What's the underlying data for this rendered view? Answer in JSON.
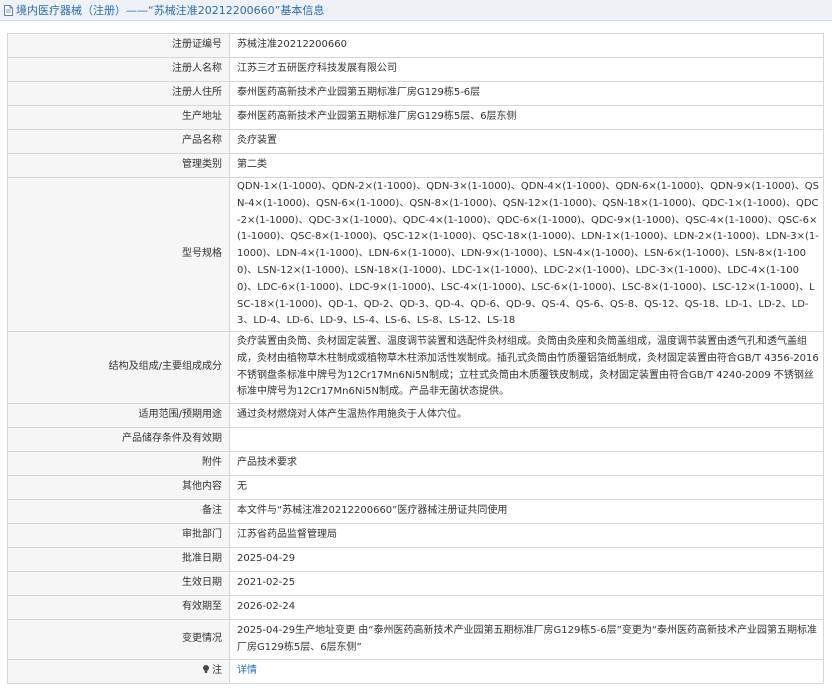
{
  "header": {
    "title": "境内医疗器械（注册）——“苏械注准20212200660”基本信息"
  },
  "rows": {
    "reg_no": {
      "label": "注册证编号",
      "value": "苏械注准20212200660"
    },
    "registrant": {
      "label": "注册人名称",
      "value": "江苏三才五研医疗科技发展有限公司"
    },
    "registrant_addr": {
      "label": "注册人住所",
      "value": "泰州医药高新技术产业园第五期标准厂房G129栋5-6层"
    },
    "prod_addr": {
      "label": "生产地址",
      "value": "泰州医药高新技术产业园第五期标准厂房G129栋5层、6层东侧"
    },
    "product_name": {
      "label": "产品名称",
      "value": "灸疗装置"
    },
    "category": {
      "label": "管理类别",
      "value": "第二类"
    },
    "models": {
      "label": "型号规格",
      "value": "QDN-1×(1-1000)、QDN-2×(1-1000)、QDN-3×(1-1000)、QDN-4×(1-1000)、QDN-6×(1-1000)、QDN-9×(1-1000)、QSN-4×(1-1000)、QSN-6×(1-1000)、QSN-8×(1-1000)、QSN-12×(1-1000)、QSN-18×(1-1000)、QDC-1×(1-1000)、QDC-2×(1-1000)、QDC-3×(1-1000)、QDC-4×(1-1000)、QDC-6×(1-1000)、QDC-9×(1-1000)、QSC-4×(1-1000)、QSC-6×(1-1000)、QSC-8×(1-1000)、QSC-12×(1-1000)、QSC-18×(1-1000)、LDN-1×(1-1000)、LDN-2×(1-1000)、LDN-3×(1-1000)、LDN-4×(1-1000)、LDN-6×(1-1000)、LDN-9×(1-1000)、LSN-4×(1-1000)、LSN-6×(1-1000)、LSN-8×(1-1000)、LSN-12×(1-1000)、LSN-18×(1-1000)、LDC-1×(1-1000)、LDC-2×(1-1000)、LDC-3×(1-1000)、LDC-4×(1-1000)、LDC-6×(1-1000)、LDC-9×(1-1000)、LSC-4×(1-1000)、LSC-6×(1-1000)、LSC-8×(1-1000)、LSC-12×(1-1000)、LSC-18×(1-1000)、QD-1、QD-2、QD-3、QD-4、QD-6、QD-9、QS-4、QS-6、QS-8、QS-12、QS-18、LD-1、LD-2、LD-3、LD-4、LD-6、LD-9、LS-4、LS-6、LS-8、LS-12、LS-18"
    },
    "structure": {
      "label": "结构及组成/主要组成成分",
      "value": "灸疗装置由灸筒、灸材固定装置、温度调节装置和选配件灸材组成。灸筒由灸座和灸筒盖组成，温度调节装置由透气孔和透气盖组成，灸材由植物草木柱制成或植物草木柱添加活性炭制成。插孔式灸筒由竹质覆铝箔纸制成，灸材固定装置由符合GB/T 4356-2016不锈钢盘条标准中牌号为12Cr17Mn6Ni5N制成；立柱式灸筒由木质覆铁皮制成，灸材固定装置由符合GB/T 4240-2009 不锈钢丝标准中牌号为12Cr17Mn6Ni5N制成。产品非无菌状态提供。"
    },
    "scope": {
      "label": "适用范围/预期用途",
      "value": "通过灸材燃烧对人体产生温热作用施灸于人体穴位。"
    },
    "storage": {
      "label": "产品储存条件及有效期",
      "value": ""
    },
    "attachment": {
      "label": "附件",
      "value": "产品技术要求"
    },
    "other": {
      "label": "其他内容",
      "value": "无"
    },
    "remark": {
      "label": "备注",
      "value": "本文件与“苏械注准20212200660”医疗器械注册证共同使用"
    },
    "dept": {
      "label": "审批部门",
      "value": "江苏省药品监督管理局"
    },
    "approve_date": {
      "label": "批准日期",
      "value": "2025-04-29"
    },
    "effective_date": {
      "label": "生效日期",
      "value": "2021-02-25"
    },
    "expiry_date": {
      "label": "有效期至",
      "value": "2026-02-24"
    },
    "changes": {
      "label": "变更情况",
      "value": "2025-04-29生产地址变更 由“泰州医药高新技术产业园第五期标准厂房G129栋5-6层”变更为“泰州医药高新技术产业园第五期标准厂房G129栋5层、6层东侧”"
    },
    "note": {
      "label": "注",
      "value": "详情"
    }
  }
}
